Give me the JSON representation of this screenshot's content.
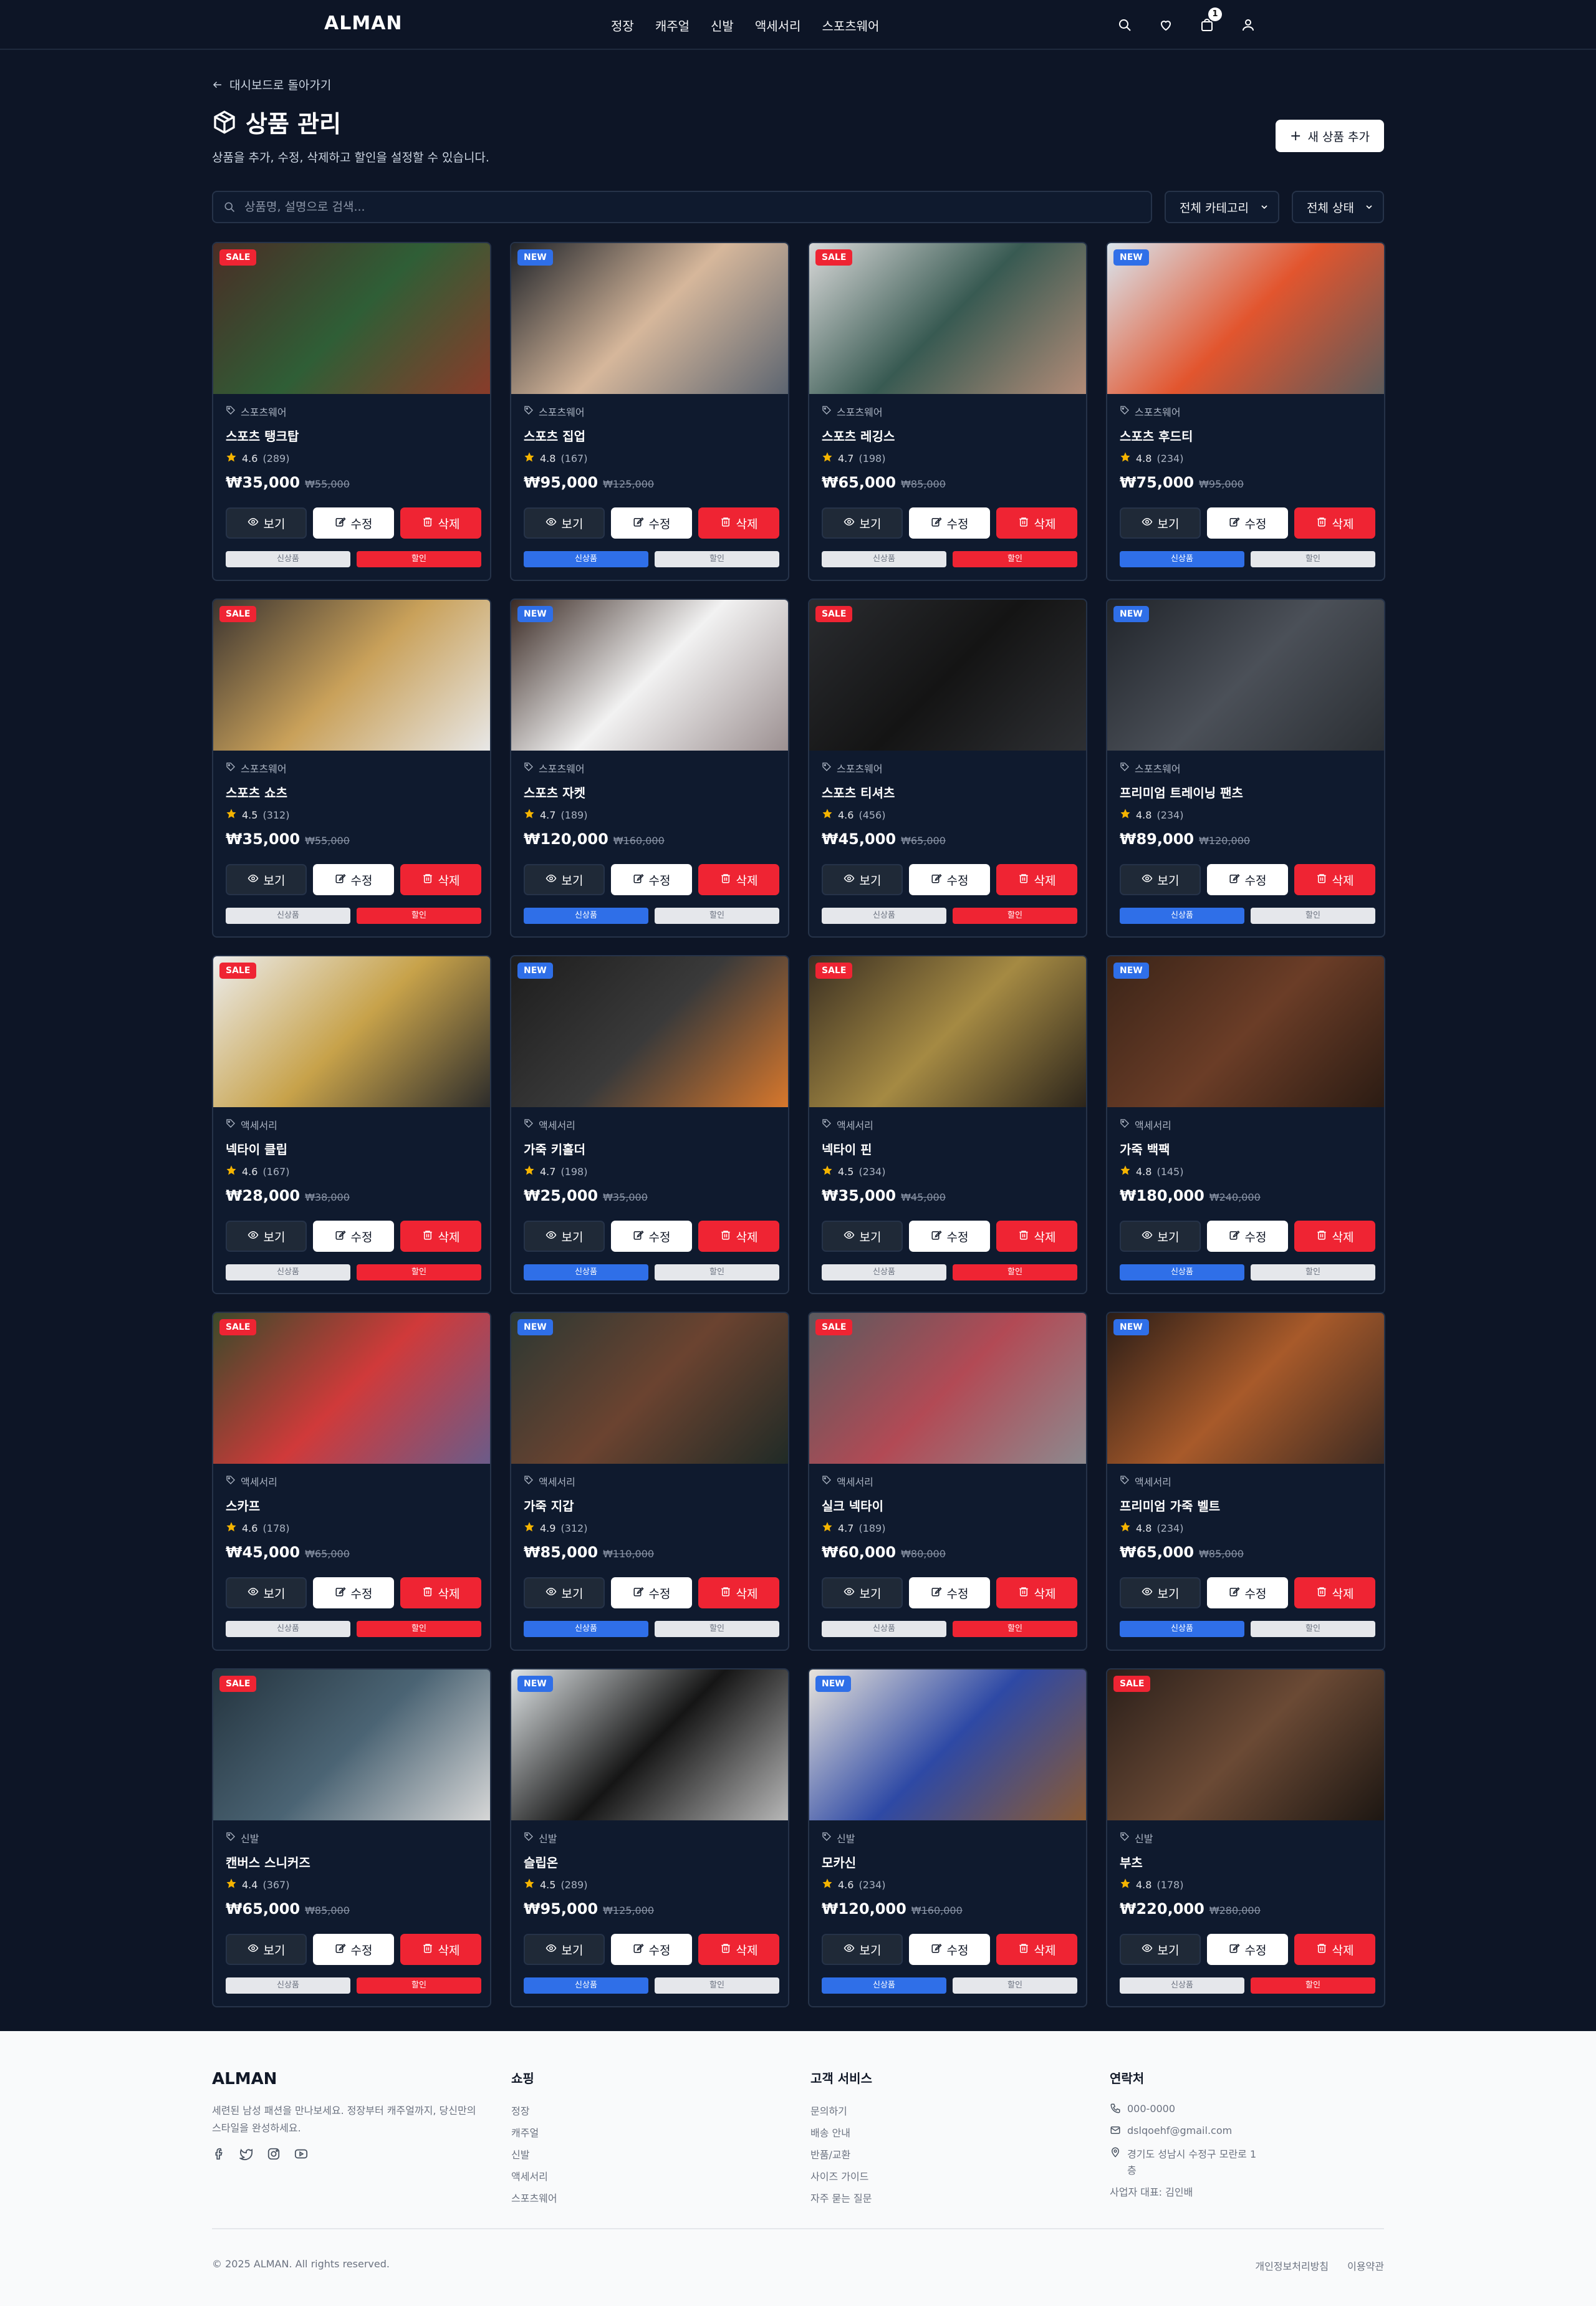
{
  "header": {
    "logo": "ALMAN",
    "nav": [
      "정장",
      "캐주얼",
      "신발",
      "액세서리",
      "스포츠웨어"
    ],
    "cart_count": "1"
  },
  "page": {
    "back_label": "대시보드로 돌아가기",
    "title": "상품 관리",
    "subtitle": "상품을 추가, 수정, 삭제하고 할인을 설정할 수 있습니다.",
    "add_button": "새 상품 추가",
    "search_placeholder": "상품명, 설명으로 검색...",
    "category_filter": "전체 카테고리",
    "status_filter": "전체 상태"
  },
  "labels": {
    "view": "보기",
    "edit": "수정",
    "delete": "삭제",
    "new_toggle": "신상품",
    "sale_toggle": "할인"
  },
  "products": [
    {
      "badge": "SALE",
      "category": "스포츠웨어",
      "name": "스포츠 탱크탑",
      "rating": "4.6",
      "reviews": "(289)",
      "price": "₩35,000",
      "old_price": "₩55,000",
      "colors": [
        "#4a2e26",
        "#2f5e36",
        "#8a3b2a"
      ]
    },
    {
      "badge": "NEW",
      "category": "스포츠웨어",
      "name": "스포츠 집업",
      "rating": "4.8",
      "reviews": "(167)",
      "price": "₩95,000",
      "old_price": "₩125,000",
      "colors": [
        "#1f2329",
        "#d6b79b",
        "#5b6470"
      ]
    },
    {
      "badge": "SALE",
      "category": "스포츠웨어",
      "name": "스포츠 레깅스",
      "rating": "4.7",
      "reviews": "(198)",
      "price": "₩65,000",
      "old_price": "₩85,000",
      "colors": [
        "#d8d8d8",
        "#385a52",
        "#b48c78"
      ]
    },
    {
      "badge": "NEW",
      "category": "스포츠웨어",
      "name": "스포츠 후드티",
      "rating": "4.8",
      "reviews": "(234)",
      "price": "₩75,000",
      "old_price": "₩95,000",
      "colors": [
        "#d9e6ef",
        "#e2552e",
        "#5b5b5b"
      ]
    },
    {
      "badge": "SALE",
      "category": "스포츠웨어",
      "name": "스포츠 쇼츠",
      "rating": "4.5",
      "reviews": "(312)",
      "price": "₩35,000",
      "old_price": "₩55,000",
      "colors": [
        "#3b3430",
        "#c9a15a",
        "#e8e8e8"
      ]
    },
    {
      "badge": "NEW",
      "category": "스포츠웨어",
      "name": "스포츠 자켓",
      "rating": "4.7",
      "reviews": "(189)",
      "price": "₩120,000",
      "old_price": "₩160,000",
      "colors": [
        "#3a2a24",
        "#f2f2f2",
        "#9b8f90"
      ]
    },
    {
      "badge": "SALE",
      "category": "스포츠웨어",
      "name": "스포츠 티셔츠",
      "rating": "4.6",
      "reviews": "(456)",
      "price": "₩45,000",
      "old_price": "₩65,000",
      "colors": [
        "#2a2c30",
        "#141414",
        "#2e3034"
      ]
    },
    {
      "badge": "NEW",
      "category": "스포츠웨어",
      "name": "프리미엄 트레이닝 팬츠",
      "rating": "4.8",
      "reviews": "(234)",
      "price": "₩89,000",
      "old_price": "₩120,000",
      "colors": [
        "#20242a",
        "#4b5058",
        "#2a2e33"
      ]
    },
    {
      "badge": "SALE",
      "category": "액세서리",
      "name": "넥타이 클립",
      "rating": "4.6",
      "reviews": "(167)",
      "price": "₩28,000",
      "old_price": "₩38,000",
      "colors": [
        "#ececec",
        "#c7a24a",
        "#2b2b2b"
      ]
    },
    {
      "badge": "NEW",
      "category": "액세서리",
      "name": "가죽 키홀더",
      "rating": "4.7",
      "reviews": "(198)",
      "price": "₩25,000",
      "old_price": "₩35,000",
      "colors": [
        "#1d1d1d",
        "#3a3a3a",
        "#d9782c"
      ]
    },
    {
      "badge": "SALE",
      "category": "액세서리",
      "name": "넥타이 핀",
      "rating": "4.5",
      "reviews": "(234)",
      "price": "₩35,000",
      "old_price": "₩45,000",
      "colors": [
        "#3a2f22",
        "#a58a43",
        "#2b241b"
      ]
    },
    {
      "badge": "NEW",
      "category": "액세서리",
      "name": "가죽 백팩",
      "rating": "4.8",
      "reviews": "(145)",
      "price": "₩180,000",
      "old_price": "₩240,000",
      "colors": [
        "#3a2418",
        "#6b3d27",
        "#2a1b13"
      ]
    },
    {
      "badge": "SALE",
      "category": "액세서리",
      "name": "스카프",
      "rating": "4.6",
      "reviews": "(178)",
      "price": "₩45,000",
      "old_price": "₩65,000",
      "colors": [
        "#3b4a2a",
        "#d03a3a",
        "#6a5c8a"
      ]
    },
    {
      "badge": "NEW",
      "category": "액세서리",
      "name": "가죽 지갑",
      "rating": "4.9",
      "reviews": "(312)",
      "price": "₩85,000",
      "old_price": "₩110,000",
      "colors": [
        "#2c3833",
        "#6b4330",
        "#1f2a26"
      ]
    },
    {
      "badge": "SALE",
      "category": "액세서리",
      "name": "실크 넥타이",
      "rating": "4.7",
      "reviews": "(189)",
      "price": "₩60,000",
      "old_price": "₩80,000",
      "colors": [
        "#5a5a5e",
        "#b24a55",
        "#8c8a8f"
      ]
    },
    {
      "badge": "NEW",
      "category": "액세서리",
      "name": "프리미엄 가죽 벨트",
      "rating": "4.8",
      "reviews": "(234)",
      "price": "₩65,000",
      "old_price": "₩85,000",
      "colors": [
        "#2a1d17",
        "#a85a2a",
        "#3b2a22"
      ]
    },
    {
      "badge": "SALE",
      "category": "신발",
      "name": "캔버스 스니커즈",
      "rating": "4.4",
      "reviews": "(367)",
      "price": "₩65,000",
      "old_price": "₩85,000",
      "colors": [
        "#24343f",
        "#4b6474",
        "#d8d8d8"
      ]
    },
    {
      "badge": "NEW",
      "category": "신발",
      "name": "슬립온",
      "rating": "4.5",
      "reviews": "(289)",
      "price": "₩95,000",
      "old_price": "₩125,000",
      "colors": [
        "#dfe4e6",
        "#151515",
        "#b9b9b9"
      ]
    },
    {
      "badge": "NEW",
      "category": "신발",
      "name": "모카신",
      "rating": "4.6",
      "reviews": "(234)",
      "price": "₩120,000",
      "old_price": "₩160,000",
      "colors": [
        "#e8e4dc",
        "#2e49a5",
        "#8a5a33"
      ]
    },
    {
      "badge": "SALE",
      "category": "신발",
      "name": "부츠",
      "rating": "4.8",
      "reviews": "(178)",
      "price": "₩220,000",
      "old_price": "₩280,000",
      "colors": [
        "#2a1f1a",
        "#6b4a35",
        "#1c1612"
      ]
    }
  ],
  "footer": {
    "logo": "ALMAN",
    "description": "세련된 남성 패션을 만나보세요. 정장부터 캐주얼까지, 당신만의 스타일을 완성하세요.",
    "shop_title": "쇼핑",
    "shop_links": [
      "정장",
      "캐주얼",
      "신발",
      "액세서리",
      "스포츠웨어"
    ],
    "service_title": "고객 서비스",
    "service_links": [
      "문의하기",
      "배송 안내",
      "반품/교환",
      "사이즈 가이드",
      "자주 묻는 질문"
    ],
    "contact_title": "연락처",
    "phone": "000-0000",
    "email": "dslqoehf@gmail.com",
    "address": "경기도 성남시 수정구 모란로 1층",
    "ceo": "사업자 대표: 김인배",
    "copyright": "© 2025 ALMAN. All rights reserved.",
    "privacy": "개인정보처리방침",
    "terms": "이용약관"
  }
}
